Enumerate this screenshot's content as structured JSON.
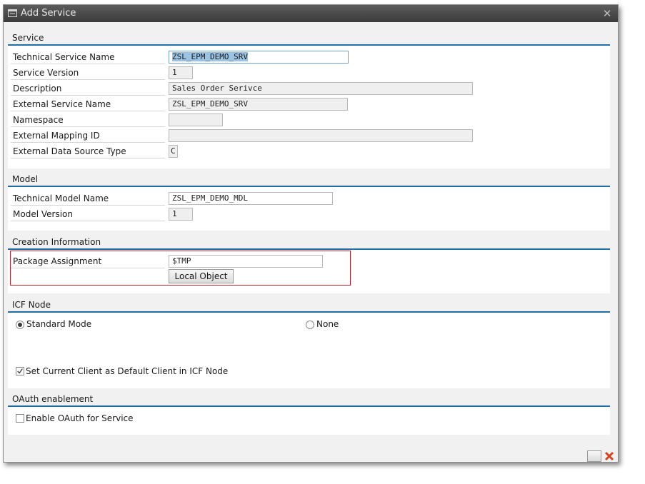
{
  "window": {
    "title": "Add Service",
    "close_glyph": "✕"
  },
  "service": {
    "title": "Service",
    "fields": [
      {
        "label": "Technical Service Name",
        "value": "ZSL_EPM_DEMO_SRV"
      },
      {
        "label": "Service Version",
        "value": "1"
      },
      {
        "label": "Description",
        "value": "Sales Order Serivce"
      },
      {
        "label": "External Service Name",
        "value": "ZSL_EPM_DEMO_SRV"
      },
      {
        "label": "Namespace",
        "value": ""
      },
      {
        "label": "External Mapping ID",
        "value": ""
      },
      {
        "label": "External Data Source Type",
        "value": "C"
      }
    ]
  },
  "model": {
    "title": "Model",
    "fields": [
      {
        "label": "Technical Model Name",
        "value": "ZSL_EPM_DEMO_MDL"
      },
      {
        "label": "Model Version",
        "value": "1"
      }
    ]
  },
  "creation": {
    "title": "Creation Information",
    "package_label": "Package Assignment",
    "package_value": "$TMP",
    "local_object_label": "Local Object"
  },
  "icf": {
    "title": "ICF Node",
    "standard_mode": "Standard Mode",
    "none": "None",
    "default_client": "Set Current Client as Default Client in ICF Node",
    "selected_mode": "Standard Mode",
    "default_client_checked": true
  },
  "oauth": {
    "title": "OAuth enablement",
    "enable_label": "Enable OAuth for Service",
    "checked": false
  },
  "colors": {
    "accent": "#1f6fa8",
    "highlight_box": "#c0202a",
    "selection": "#9bc3e4"
  },
  "icons": {
    "title": "dialog-window-icon",
    "close": "close-icon",
    "check": "checkmark-icon"
  }
}
